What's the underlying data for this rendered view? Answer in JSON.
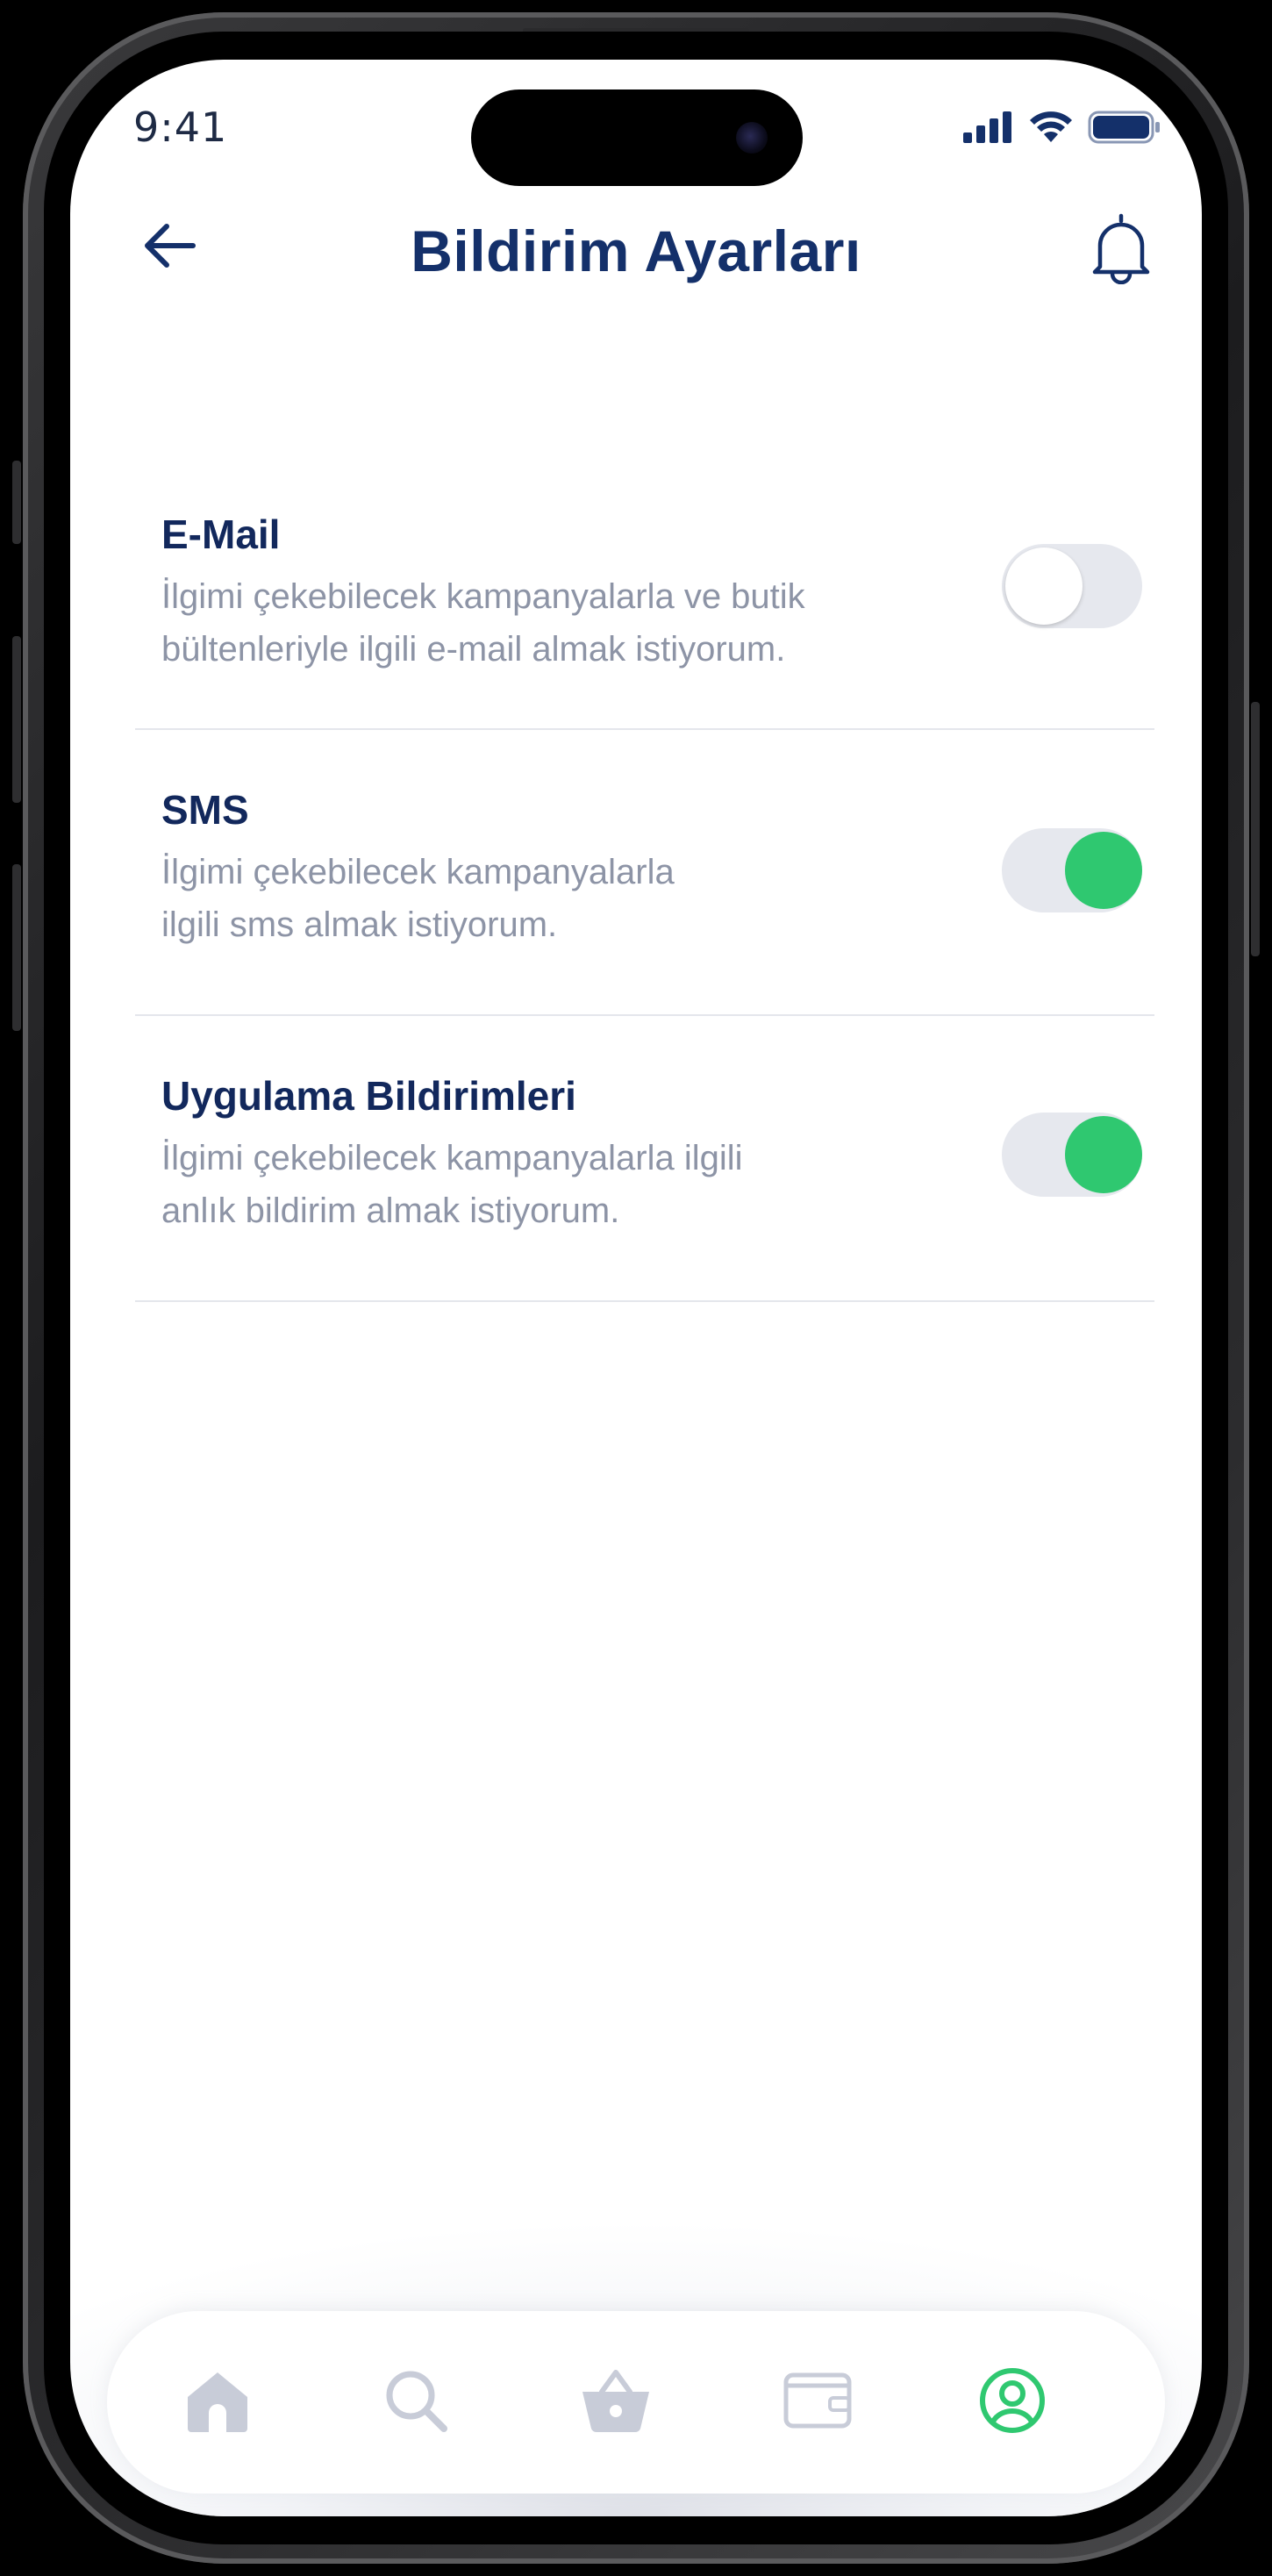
{
  "status": {
    "time": "9:41",
    "icons": [
      "signal-icon",
      "wifi-icon",
      "battery-icon"
    ]
  },
  "header": {
    "title": "Bildirim Ayarları",
    "back_icon": "arrow-left-icon",
    "bell_icon": "bell-icon"
  },
  "settings": [
    {
      "label": "E-Mail",
      "desc_lines": [
        "İlgimi çekebilecek kampanyalarla ve butik",
        "bültenleriyle ilgili e-mail almak istiyorum."
      ],
      "enabled": false
    },
    {
      "label": "SMS",
      "desc_lines": [
        "İlgimi çekebilecek kampanyalarla",
        "ilgili sms almak istiyorum."
      ],
      "enabled": true
    },
    {
      "label": "Uygulama Bildirimleri",
      "desc_lines": [
        "İlgimi çekebilecek kampanyalarla ilgili",
        "anlık bildirim almak istiyorum."
      ],
      "enabled": true
    }
  ],
  "tabbar": {
    "items": [
      "home-icon",
      "search-icon",
      "basket-icon",
      "wallet-icon",
      "profile-icon"
    ],
    "active": "profile-icon"
  },
  "colors": {
    "primary": "#14306a",
    "accent_green": "#2fc870",
    "muted": "#8d94a6",
    "inactive_icon": "#c8ccd8"
  }
}
